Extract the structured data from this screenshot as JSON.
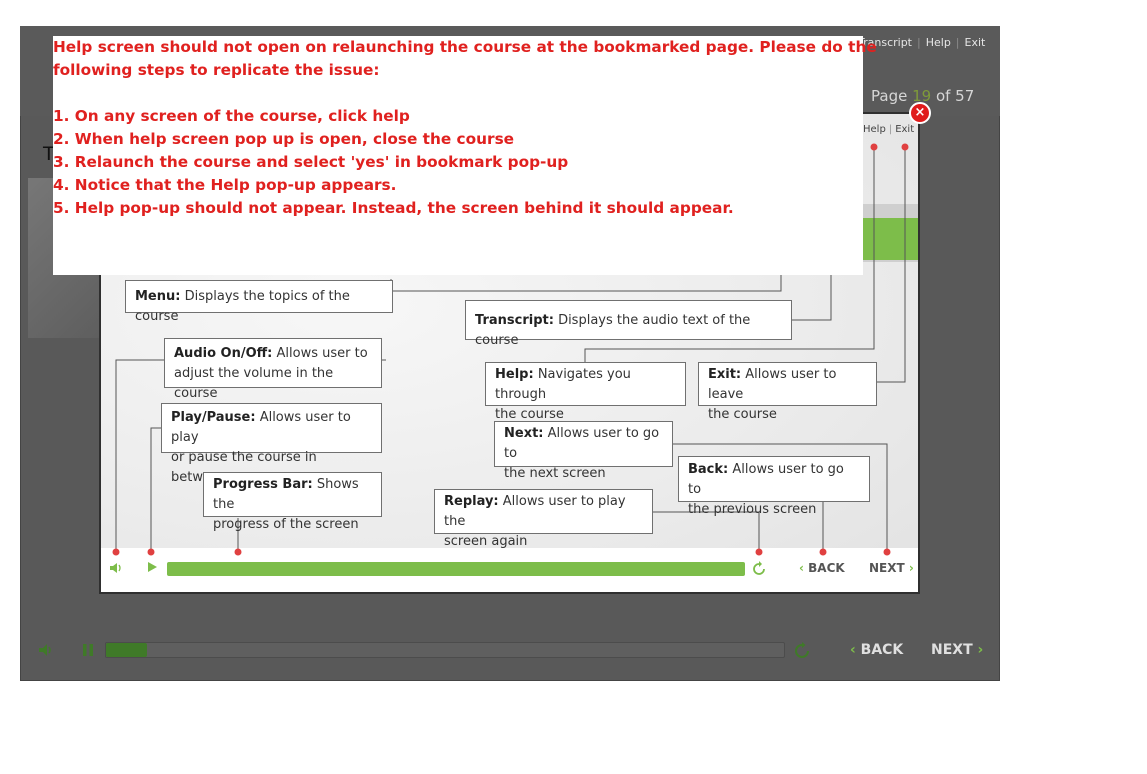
{
  "player": {
    "top_links": [
      "Transcript",
      "Help",
      "Exit"
    ],
    "page_prefix": "Page ",
    "page_current": "19",
    "page_suffix": " of 57",
    "stray_text": "T",
    "controls": {
      "back_label": "BACK",
      "next_label": "NEXT"
    },
    "progress_fraction": 0.06
  },
  "help_popup": {
    "close_symbol": "×",
    "top_links": [
      "Help",
      "Exit"
    ],
    "callouts": {
      "menu": {
        "title": "Menu:",
        "text": "Displays the topics of the course"
      },
      "transcript": {
        "title": "Transcript:",
        "text": "Displays the audio text of the course"
      },
      "audio": {
        "title": "Audio On/Off:",
        "text_line1": "Allows user to",
        "text_line2": "adjust the volume in the course"
      },
      "help": {
        "title": "Help:",
        "text_line1": "Navigates you through",
        "text_line2": "the course"
      },
      "exit": {
        "title": "Exit:",
        "text_line1": "Allows user to leave",
        "text_line2": "the course"
      },
      "play_pause": {
        "title": "Play/Pause:",
        "text_line1": "Allows user to play",
        "text_line2": "or pause the course in between"
      },
      "next": {
        "title": "Next:",
        "text_line1": "Allows user to go to",
        "text_line2": "the next screen"
      },
      "back": {
        "title": "Back:",
        "text_line1": "Allows user to go to",
        "text_line2": "the previous screen"
      },
      "progress_bar": {
        "title": "Progress Bar:",
        "text_line1": "Shows the",
        "text_line2": "progress of the screen"
      },
      "replay": {
        "title": "Replay:",
        "text_line1": "Allows user to play the",
        "text_line2": "screen again"
      }
    },
    "footer": {
      "back_label": "BACK",
      "next_label": "NEXT",
      "progress_fraction": 1.0
    }
  },
  "bug_note": {
    "lines": [
      "Help screen should not open on relaunching the course at the bookmarked page. Please do the",
      "following steps to replicate the issue:",
      "",
      "1. On any screen of the course, click help",
      "2. When help screen pop up is open, close the course",
      "3. Relaunch the course and select 'yes' in bookmark pop-up",
      "4. Notice that the Help pop-up appears.",
      "5. Help pop-up should not appear. Instead, the screen behind it should appear."
    ]
  },
  "colors": {
    "player_bg": "#595959",
    "accent_green": "#7dbd4a",
    "note_red": "#e0211f",
    "close_red": "#e01b1b"
  }
}
